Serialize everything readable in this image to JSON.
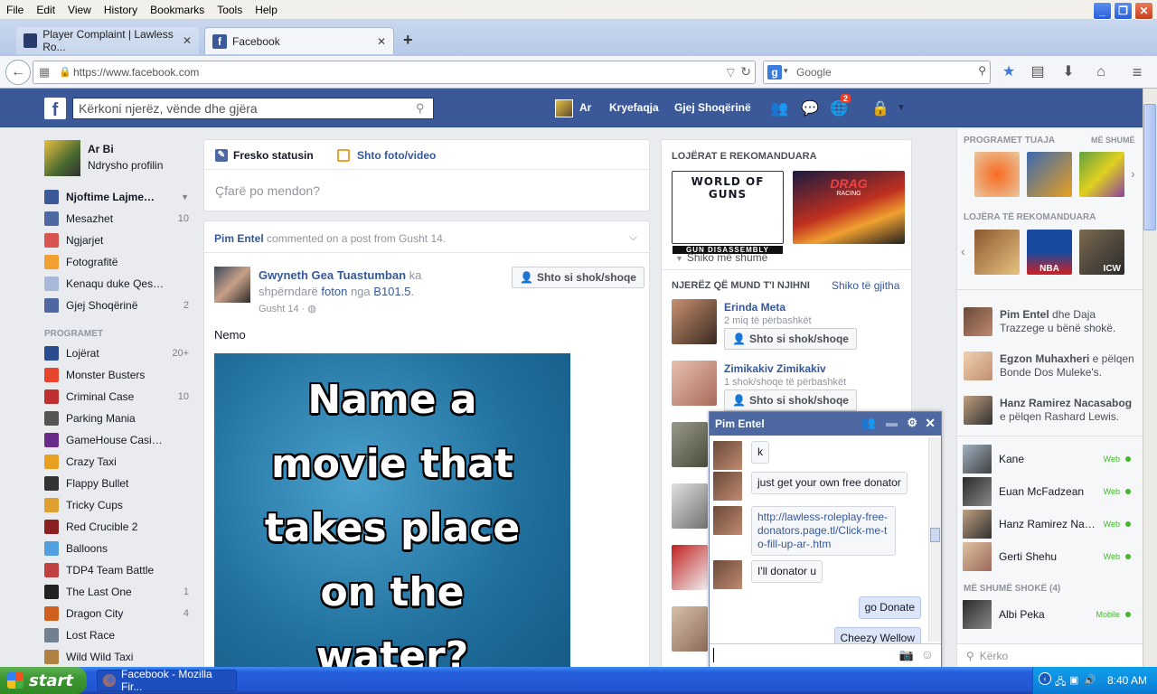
{
  "browser": {
    "menu": [
      "File",
      "Edit",
      "View",
      "History",
      "Bookmarks",
      "Tools",
      "Help"
    ],
    "tabs": [
      {
        "title": "Player Complaint | Lawless Ro...",
        "active": false
      },
      {
        "title": "Facebook",
        "active": true
      }
    ],
    "url": "https://www.facebook.com",
    "search_placeholder": "Google"
  },
  "fb": {
    "search_placeholder": "Kërkoni njerëz, vënde dhe gjëra",
    "user_short": "Ar",
    "home": "Kryefaqja",
    "find_friends": "Gjej Shoqërinë",
    "notif_count": "2"
  },
  "left": {
    "profile_name": "Ar Bi",
    "edit_profile": "Ndrysho profilin",
    "items": [
      {
        "label": "Njoftime Lajme…",
        "count": "",
        "color": "#3b5998"
      },
      {
        "label": "Mesazhet",
        "count": "10",
        "color": "#4e69a2"
      },
      {
        "label": "Ngjarjet",
        "count": "",
        "color": "#d9534f"
      },
      {
        "label": "Fotografitë",
        "count": "",
        "color": "#f0a030"
      },
      {
        "label": "Kenaqu duke Qes…",
        "count": "",
        "color": "#a8b8d8"
      },
      {
        "label": "Gjej Shoqërinë",
        "count": "2",
        "color": "#4e69a2"
      }
    ],
    "section_apps": "PROGRAMET",
    "apps": [
      {
        "label": "Lojërat",
        "count": "20+",
        "color": "#2a4b8d"
      },
      {
        "label": "Monster Busters",
        "count": "",
        "color": "#e8452c"
      },
      {
        "label": "Criminal Case",
        "count": "10",
        "color": "#c03030"
      },
      {
        "label": "Parking Mania",
        "count": "",
        "color": "#555"
      },
      {
        "label": "GameHouse Casi…",
        "count": "",
        "color": "#6a2a8a"
      },
      {
        "label": "Crazy Taxi",
        "count": "",
        "color": "#e8a020"
      },
      {
        "label": "Flappy Bullet",
        "count": "",
        "color": "#333"
      },
      {
        "label": "Tricky Cups",
        "count": "",
        "color": "#e0a030"
      },
      {
        "label": "Red Crucible 2",
        "count": "",
        "color": "#8a2020"
      },
      {
        "label": "Balloons",
        "count": "",
        "color": "#50a0e0"
      },
      {
        "label": "TDP4 Team Battle",
        "count": "",
        "color": "#c04040"
      },
      {
        "label": "The Last One",
        "count": "1",
        "color": "#222"
      },
      {
        "label": "Dragon City",
        "count": "4",
        "color": "#d06020"
      },
      {
        "label": "Lost Race",
        "count": "",
        "color": "#708090"
      },
      {
        "label": "Wild Wild Taxi",
        "count": "",
        "color": "#b08040"
      }
    ]
  },
  "composer": {
    "status_tab": "Fresko statusin",
    "photo_tab": "Shto foto/video",
    "placeholder": "Çfarë po mendon?"
  },
  "post": {
    "story_actor": "Pim Entel",
    "story_text": "commented on a post from Gusht 14.",
    "author": "Gwyneth Gea Tuastumban",
    "shared_1": "ka",
    "shared_2": "shpërndarë",
    "foto": "foton",
    "nga": "nga",
    "page": "B101.5",
    "time": "Gusht 14 ·",
    "add_friend": "Shto si shok/shoqe",
    "caption": "Nemo",
    "meme_lines": [
      "Name a",
      "movie that",
      "takes place",
      "on the",
      "water?"
    ]
  },
  "right": {
    "games_title": "LOJËRAT E REKOMANDUARA",
    "game1_text": "WORLD OF GUNS",
    "game1_sub": "GUN DISASSEMBLY",
    "game2_text": "DRAG",
    "game2_sub": "RACING",
    "see_more": "Shiko më shumë",
    "pymk_title": "NJERËZ QË MUND T'I NJIHNI",
    "see_all": "Shiko të gjitha",
    "people": [
      {
        "name": "Erinda Meta",
        "mutual": "2 miq të përbashkët",
        "btn": "Shto si shok/shoqe"
      },
      {
        "name": "Zimikakiv Zimikakiv",
        "mutual": "1 shok/shoqe të përbashkët",
        "btn": "Shto si shok/shoqe"
      }
    ]
  },
  "farright": {
    "apps_title": "PROGRAMET TUAJA",
    "more": "MË SHUMË",
    "games_title": "LOJËRA TË REKOMANDUARA",
    "nba": "NBA",
    "icw": "ICW",
    "ticker": [
      {
        "bold": "Pim Entel",
        "text": " dhe Daja Trazzege u bënë shokë."
      },
      {
        "bold": "Egzon Muhaxheri",
        "text": " e pëlqen Bonde Dos Muleke's."
      },
      {
        "bold": "Hanz Ramirez Nacasabog",
        "text": " e pëlqen Rashard Lewis."
      }
    ],
    "contacts": [
      {
        "name": "Kane",
        "status": "Web"
      },
      {
        "name": "Euan McFadzean",
        "status": "Web"
      },
      {
        "name": "Hanz Ramirez Na…",
        "status": "Web"
      },
      {
        "name": "Gerti Shehu",
        "status": "Web"
      }
    ],
    "more_friends": "MË SHUMË SHOKË (4)",
    "more_contact": {
      "name": "Albi Peka",
      "status": "Mobile"
    },
    "search_placeholder": "Kërko"
  },
  "chat": {
    "name": "Pim Entel",
    "messages": [
      {
        "text": "k",
        "me": false
      },
      {
        "text": "just get your own free donator",
        "me": false
      },
      {
        "text": "http://lawless-roleplay-free-donators.page.tl/Click-me-to-fill-up-ar-.htm",
        "me": false
      },
      {
        "text": "I'll donator u",
        "me": false
      },
      {
        "text": "go Donate",
        "me": true
      },
      {
        "text": "Cheezy Wellow",
        "me": true
      }
    ]
  },
  "taskbar": {
    "start": "start",
    "item": "Facebook - Mozilla Fir...",
    "time": "8:40 AM"
  }
}
